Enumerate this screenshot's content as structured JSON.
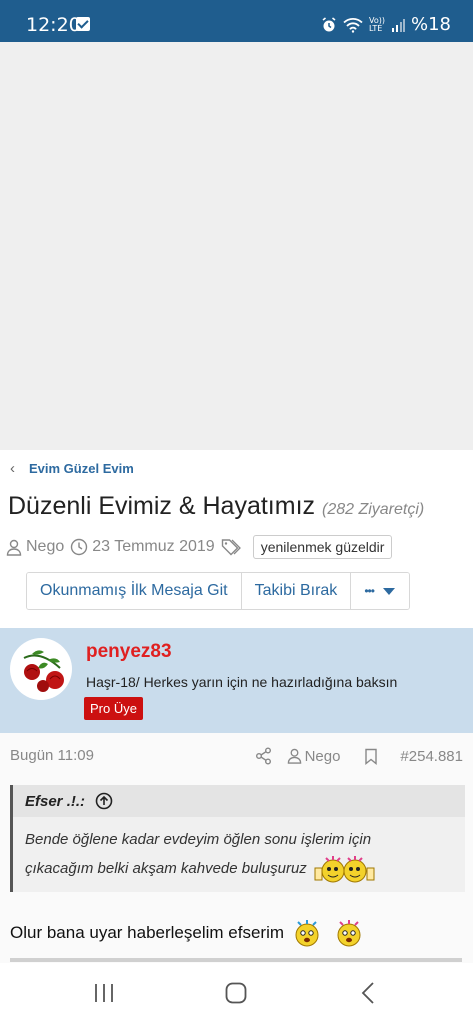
{
  "status_bar": {
    "time": "12:20",
    "volte": "Vo))",
    "lte": "LTE",
    "battery": "%18"
  },
  "breadcrumb": {
    "label": "Evim Güzel Evim"
  },
  "thread": {
    "title": "Düzenli Evimiz & Hayatımız",
    "visitors": "(282 Ziyaretçi)",
    "author": "Nego",
    "date": "23 Temmuz 2019",
    "tag": "yenilenmek güzeldir"
  },
  "actions": {
    "unread": "Okunmamış İlk Mesaja Git",
    "unwatch": "Takibi Bırak",
    "more": "•••"
  },
  "post": {
    "username": "penyez83",
    "user_title": "Haşr-18/ Herkes yarın için ne hazırladığına baksın",
    "badge": "Pro Üye",
    "time": "Bugün 11:09",
    "reply_to": "Nego",
    "number": "#254.881",
    "quote": {
      "author": "Efser .!.:",
      "line1": "Bende öğlene kadar evdeyim öğlen sonu işlerim için",
      "line2": "çıkacağım belki akşam kahvede buluşuruz"
    },
    "body": "Olur bana uyar haberleşelim efserim"
  },
  "icons": [
    "alarm-icon",
    "wifi-icon",
    "signal-icon",
    "back-chevron-icon",
    "user-icon",
    "clock-icon",
    "tag-icon",
    "share-icon",
    "bookmark-icon",
    "arrow-up-circle-icon",
    "nav-recents-icon",
    "nav-home-icon",
    "nav-back-icon"
  ],
  "colors": {
    "status_bar": "#1f5d8e",
    "link": "#2d6aa0",
    "username": "#e02020",
    "badge": "#cc1010",
    "user_box": "#c9dcec"
  }
}
